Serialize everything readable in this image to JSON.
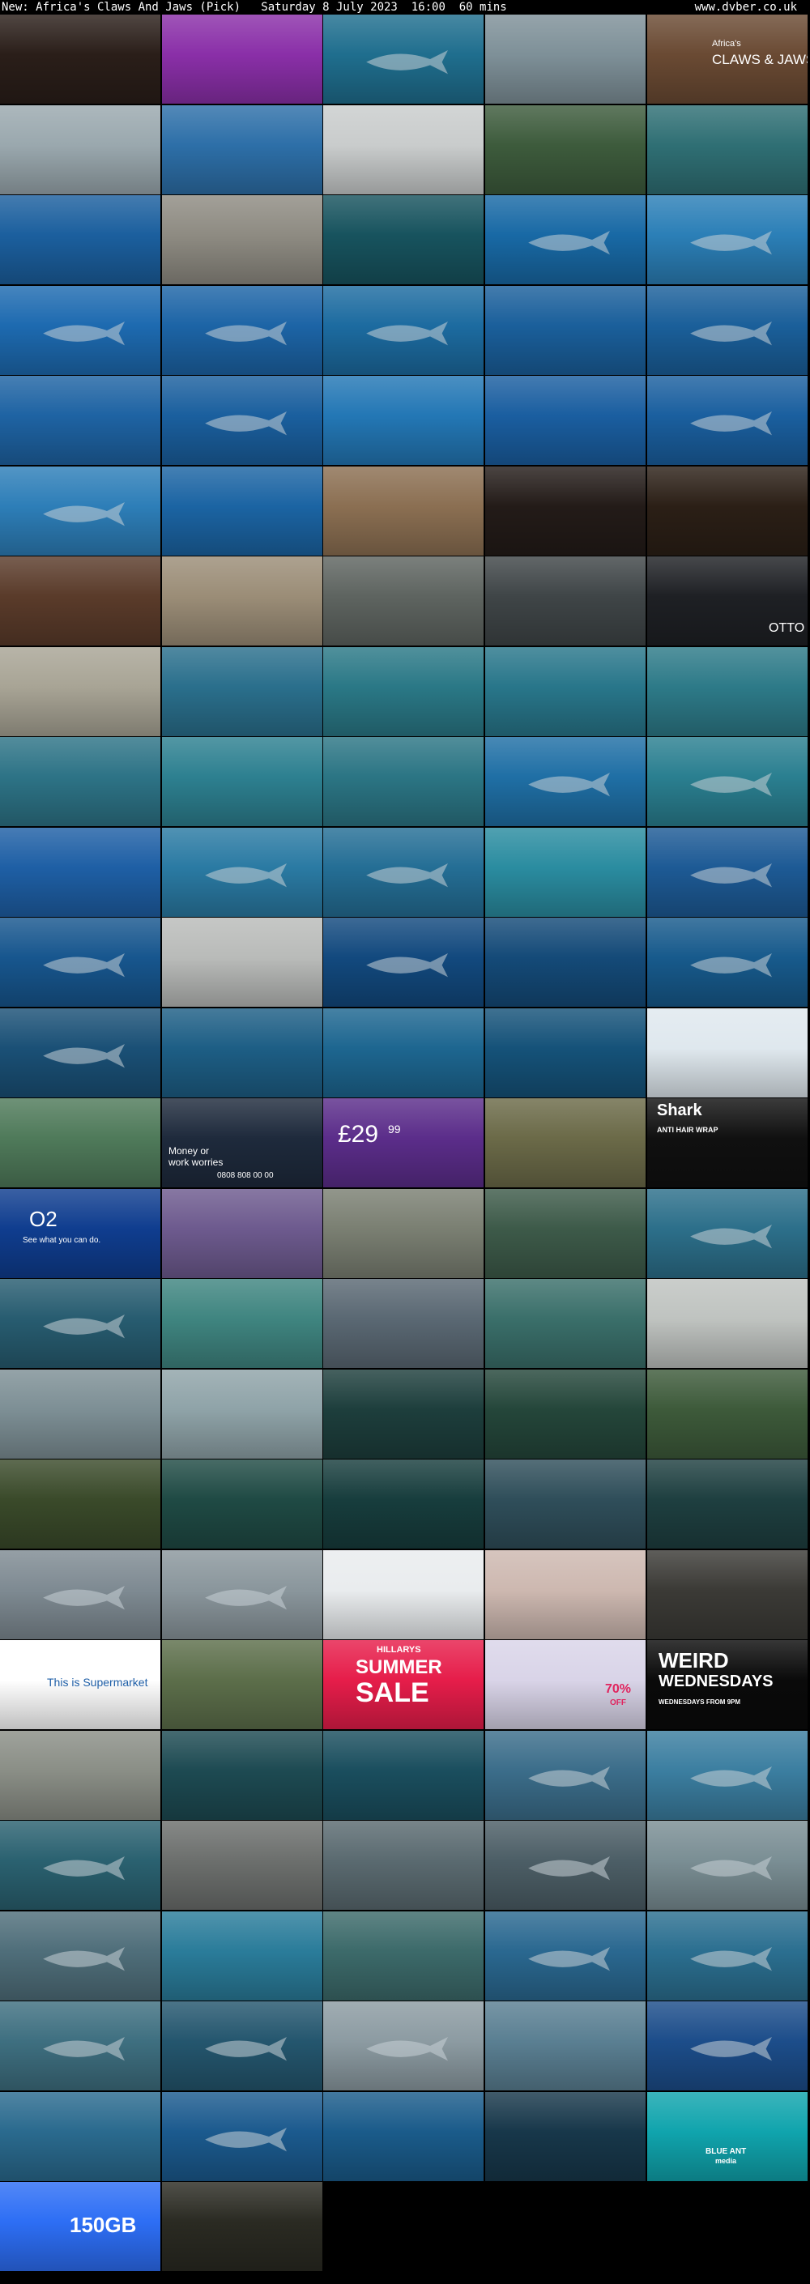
{
  "header": {
    "title": "New: Africa's Claws And Jaws (Pick)   Saturday 8 July 2023  16:00  60 mins",
    "site": "www.dvber.co.uk"
  },
  "grid": {
    "columns": 5,
    "tiles": [
      {
        "bg": "#2a1e19",
        "kind": "food"
      },
      {
        "bg": "#8a2fa8",
        "kind": "cat"
      },
      {
        "bg": "#1f6e8e",
        "kind": "shark-under"
      },
      {
        "bg": "#7e9098",
        "kind": "sea-surface"
      },
      {
        "bg": "#6a4a33",
        "kind": "title-card",
        "text": [
          "Africa's",
          "CLAWS & JAWS"
        ]
      },
      {
        "bg": "#9aa8ae",
        "kind": "diver-shore"
      },
      {
        "bg": "#2d6fa8",
        "kind": "surfer"
      },
      {
        "bg": "#c9cccc",
        "kind": "beach"
      },
      {
        "bg": "#3d5b3c",
        "kind": "reef-shark"
      },
      {
        "bg": "#2f6f74",
        "kind": "water"
      },
      {
        "bg": "#1b5f9e",
        "kind": "diver"
      },
      {
        "bg": "#8e8b82",
        "kind": "beach"
      },
      {
        "bg": "#17535e",
        "kind": "reef"
      },
      {
        "bg": "#1869a5",
        "kind": "shark"
      },
      {
        "bg": "#2b7fb7",
        "kind": "shark"
      },
      {
        "bg": "#1d6ab0",
        "kind": "shark"
      },
      {
        "bg": "#1c64a6",
        "kind": "shark"
      },
      {
        "bg": "#1c6ba0",
        "kind": "shark"
      },
      {
        "bg": "#1a5f9b",
        "kind": "diver"
      },
      {
        "bg": "#1a5f9a",
        "kind": "shark"
      },
      {
        "bg": "#1e63a3",
        "kind": "water"
      },
      {
        "bg": "#1a5f9e",
        "kind": "shark"
      },
      {
        "bg": "#2377b5",
        "kind": "infographic"
      },
      {
        "bg": "#1a5ea0",
        "kind": "water"
      },
      {
        "bg": "#1a5f9f",
        "kind": "shark"
      },
      {
        "bg": "#2d7eb8",
        "kind": "shark"
      },
      {
        "bg": "#1b64a3",
        "kind": "water"
      },
      {
        "bg": "#8b6f52",
        "kind": "building"
      },
      {
        "bg": "#231b18",
        "kind": "tv-ad"
      },
      {
        "bg": "#2b1f16",
        "kind": "ad-people"
      },
      {
        "bg": "#5a3b2a",
        "kind": "crowd"
      },
      {
        "bg": "#9b8d77",
        "kind": "market"
      },
      {
        "bg": "#5e6460",
        "kind": "people"
      },
      {
        "bg": "#3f4547",
        "kind": "tv-ad"
      },
      {
        "bg": "#1e2024",
        "kind": "otto",
        "text": [
          "OTTO"
        ]
      },
      {
        "bg": "#a8a495",
        "kind": "beach"
      },
      {
        "bg": "#2a6f8c",
        "kind": "reef"
      },
      {
        "bg": "#2a7886",
        "kind": "reef"
      },
      {
        "bg": "#28768a",
        "kind": "reef"
      },
      {
        "bg": "#2d7a88",
        "kind": "reef"
      },
      {
        "bg": "#2d7386",
        "kind": "reef"
      },
      {
        "bg": "#2d8090",
        "kind": "water"
      },
      {
        "bg": "#2b7584",
        "kind": "reef"
      },
      {
        "bg": "#1f6fa5",
        "kind": "shark"
      },
      {
        "bg": "#2a7f90",
        "kind": "shark"
      },
      {
        "bg": "#1e5fa5",
        "kind": "water"
      },
      {
        "bg": "#2a7aa3",
        "kind": "shark"
      },
      {
        "bg": "#246e95",
        "kind": "shark"
      },
      {
        "bg": "#2a8ca0",
        "kind": "sea-surface"
      },
      {
        "bg": "#1d5a95",
        "kind": "whale-shark"
      },
      {
        "bg": "#17568e",
        "kind": "whale-shark"
      },
      {
        "bg": "#b9bbb9",
        "kind": "boat"
      },
      {
        "bg": "#12497e",
        "kind": "whale-shark"
      },
      {
        "bg": "#144a78",
        "kind": "water"
      },
      {
        "bg": "#175a8c",
        "kind": "whale-shark"
      },
      {
        "bg": "#1a5076",
        "kind": "whale-shark"
      },
      {
        "bg": "#1d5e85",
        "kind": "water"
      },
      {
        "bg": "#1d6690",
        "kind": "water"
      },
      {
        "bg": "#155279",
        "kind": "water"
      },
      {
        "bg": "#dfe8ee",
        "kind": "lenor-ad"
      },
      {
        "bg": "#4f7a5a",
        "kind": "river"
      },
      {
        "bg": "#1e2a3c",
        "kind": "macmillan-ad",
        "text": [
          "Money or",
          "work worries",
          "0808 808 00 00"
        ]
      },
      {
        "bg": "#5b2d8a",
        "kind": "price-ad",
        "text": [
          "£29",
          "99"
        ]
      },
      {
        "bg": "#6b6a48",
        "kind": "aerial"
      },
      {
        "bg": "#101010",
        "kind": "shark-ad",
        "text": [
          "Shark",
          "ANTI HAIR WRAP"
        ]
      },
      {
        "bg": "#0f3d8f",
        "kind": "o2-ad",
        "text": [
          "O2",
          "See what you can do."
        ]
      },
      {
        "bg": "#6d5a8e",
        "kind": "people"
      },
      {
        "bg": "#7a7f72",
        "kind": "crocodile"
      },
      {
        "bg": "#3d5a49",
        "kind": "aerial"
      },
      {
        "bg": "#2c6f8a",
        "kind": "shark"
      },
      {
        "bg": "#275c70",
        "kind": "shark"
      },
      {
        "bg": "#3f8580",
        "kind": "coast"
      },
      {
        "bg": "#5a6873",
        "kind": "town"
      },
      {
        "bg": "#3a6f6a",
        "kind": "water"
      },
      {
        "bg": "#bfc3c0",
        "kind": "person-coast"
      },
      {
        "bg": "#7d8f95",
        "kind": "surfer"
      },
      {
        "bg": "#8fa3a8",
        "kind": "person-coast"
      },
      {
        "bg": "#1d3e3c",
        "kind": "kelp"
      },
      {
        "bg": "#24463a",
        "kind": "kelp"
      },
      {
        "bg": "#3d5a3a",
        "kind": "kelp"
      },
      {
        "bg": "#3a4a2a",
        "kind": "kelp"
      },
      {
        "bg": "#1f4a44",
        "kind": "kelp"
      },
      {
        "bg": "#173d3d",
        "kind": "kelp"
      },
      {
        "bg": "#2f4e5a",
        "kind": "reef"
      },
      {
        "bg": "#1e3f40",
        "kind": "kelp"
      },
      {
        "bg": "#7e8a92",
        "kind": "dolphin"
      },
      {
        "bg": "#8a969c",
        "kind": "dolphin"
      },
      {
        "bg": "#e9ecee",
        "kind": "product-ad"
      },
      {
        "bg": "#cdb8b0",
        "kind": "people"
      },
      {
        "bg": "#3b3a36",
        "kind": "marie-curie-ad"
      },
      {
        "bg": "#ffffff",
        "kind": "supermarket-ad",
        "text": [
          "This is Supermarket"
        ]
      },
      {
        "bg": "#5c6e4a",
        "kind": "people"
      },
      {
        "bg": "#e61d4a",
        "kind": "hillarys-ad",
        "text": [
          "HILLARYS",
          "SUMMER",
          "SALE"
        ]
      },
      {
        "bg": "#d9d4e8",
        "kind": "studio-ad",
        "text": [
          "70%",
          "OFF"
        ]
      },
      {
        "bg": "#0a0a0a",
        "kind": "weird-wed",
        "text": [
          "WEIRD",
          "WEDNESDAYS",
          "WEDNESDAYS FROM 9PM"
        ]
      },
      {
        "bg": "#8a8e86",
        "kind": "seal"
      },
      {
        "bg": "#1d4a52",
        "kind": "water"
      },
      {
        "bg": "#1a4e5e",
        "kind": "water"
      },
      {
        "bg": "#3b6d8a",
        "kind": "shark"
      },
      {
        "bg": "#3b7ea0",
        "kind": "shark"
      },
      {
        "bg": "#2a6170",
        "kind": "shark"
      },
      {
        "bg": "#6c6f6d",
        "kind": "seals-rock"
      },
      {
        "bg": "#5a6a70",
        "kind": "sea-surface"
      },
      {
        "bg": "#4c5e66",
        "kind": "shark-breach"
      },
      {
        "bg": "#7a8e94",
        "kind": "shark-breach"
      },
      {
        "bg": "#4f6e7a",
        "kind": "shark"
      },
      {
        "bg": "#2a7c9a",
        "kind": "fish"
      },
      {
        "bg": "#3c6a6a",
        "kind": "boat"
      },
      {
        "bg": "#2a6890",
        "kind": "shark"
      },
      {
        "bg": "#2b6f90",
        "kind": "shark"
      },
      {
        "bg": "#3e6f80",
        "kind": "shark"
      },
      {
        "bg": "#24566e",
        "kind": "shark"
      },
      {
        "bg": "#8c9ba2",
        "kind": "shark-breach"
      },
      {
        "bg": "#5a7f92",
        "kind": "sea-surface"
      },
      {
        "bg": "#1c4d8a",
        "kind": "shark"
      },
      {
        "bg": "#2a6a8e",
        "kind": "divers"
      },
      {
        "bg": "#1b5a8e",
        "kind": "shark"
      },
      {
        "bg": "#1a5b8a",
        "kind": "diver"
      },
      {
        "bg": "#17374a",
        "kind": "diver"
      },
      {
        "bg": "#10a4ad",
        "kind": "blue-ant",
        "text": [
          "BLUE ANT",
          "media"
        ]
      },
      {
        "bg": "#2d6ef5",
        "kind": "sim-ad",
        "text": [
          "150GB"
        ]
      },
      {
        "bg": "#2a2a22",
        "kind": "projector"
      }
    ]
  }
}
